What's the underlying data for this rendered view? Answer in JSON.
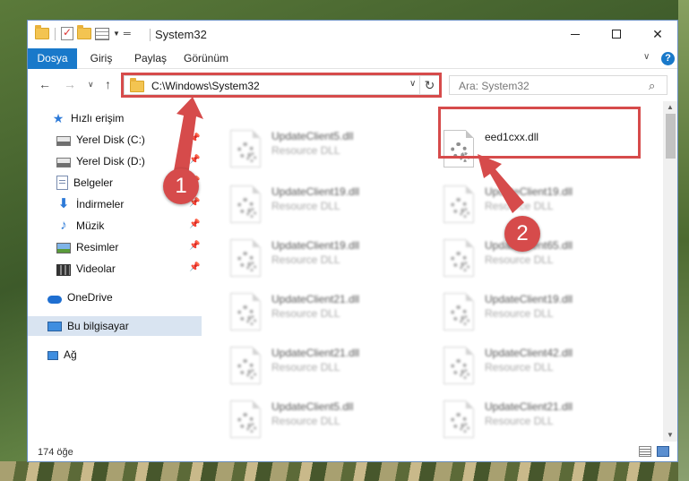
{
  "window": {
    "title": "System32",
    "controls": {
      "minimize": "minimize",
      "maximize": "maximize",
      "close": "✕"
    }
  },
  "ribbon": {
    "tabs": [
      {
        "label": "Dosya",
        "active": true
      },
      {
        "label": "Giriş"
      },
      {
        "label": "Paylaş"
      },
      {
        "label": "Görünüm"
      }
    ],
    "help": "?"
  },
  "address": {
    "path": "C:\\Windows\\System32",
    "search_placeholder": "Ara: System32"
  },
  "sidebar": {
    "items": [
      {
        "label": "Hızlı erişim",
        "icon": "star-icon"
      },
      {
        "label": "Yerel Disk (C:)",
        "icon": "drive-icon"
      },
      {
        "label": "Yerel Disk (D:)",
        "icon": "drive-icon"
      },
      {
        "label": "Belgeler",
        "icon": "document-icon"
      },
      {
        "label": "İndirmeler",
        "icon": "download-icon"
      },
      {
        "label": "Müzik",
        "icon": "music-icon"
      },
      {
        "label": "Resimler",
        "icon": "pictures-icon"
      },
      {
        "label": "Videolar",
        "icon": "video-icon"
      },
      {
        "label": "OneDrive",
        "icon": "cloud-icon"
      },
      {
        "label": "Bu bilgisayar",
        "icon": "computer-icon"
      },
      {
        "label": "Ağ",
        "icon": "network-icon"
      }
    ]
  },
  "files": [
    {
      "name": "UpdateClient5.dll",
      "type": "Resource DLL"
    },
    {
      "name": "eed1cxx.dll",
      "type": ""
    },
    {
      "name": "UpdateClient19.dll",
      "type": "Resource DLL"
    },
    {
      "name": "UpdateClient19.dll",
      "type": "Resource DLL"
    },
    {
      "name": "UpdateClient19.dll",
      "type": "Resource DLL"
    },
    {
      "name": "UpdateClient65.dll",
      "type": "Resource DLL"
    },
    {
      "name": "UpdateClient21.dll",
      "type": "Resource DLL"
    },
    {
      "name": "UpdateClient19.dll",
      "type": "Resource DLL"
    },
    {
      "name": "UpdateClient21.dll",
      "type": "Resource DLL"
    },
    {
      "name": "UpdateClient42.dll",
      "type": "Resource DLL"
    },
    {
      "name": "UpdateClient5.dll",
      "type": "Resource DLL"
    },
    {
      "name": "UpdateClient21.dll",
      "type": "Resource DLL"
    }
  ],
  "status": {
    "count": "174 öğe"
  },
  "annotations": {
    "step1": "1",
    "step2": "2",
    "color": "#d64b4b"
  }
}
